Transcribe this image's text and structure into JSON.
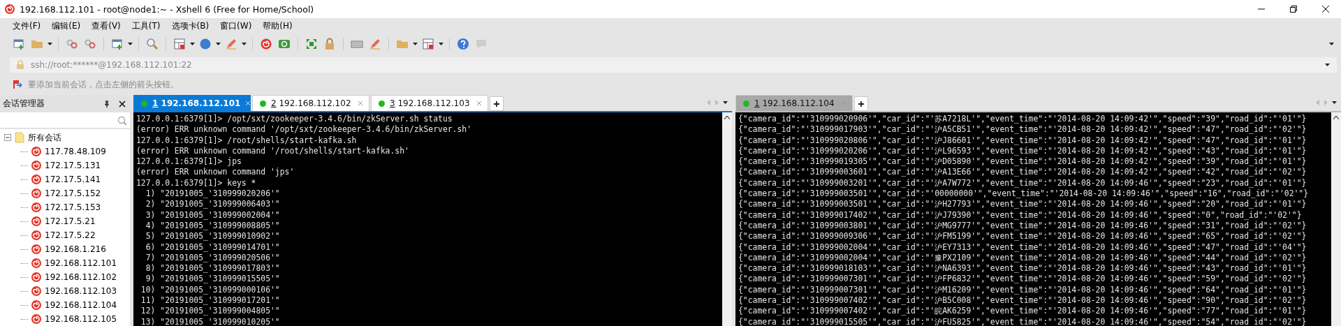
{
  "window": {
    "title": "192.168.112.101 - root@node1:~ - Xshell 6 (Free for Home/School)"
  },
  "menu": [
    "文件(F)",
    "编辑(E)",
    "查看(V)",
    "工具(T)",
    "选项卡(B)",
    "窗口(W)",
    "帮助(H)"
  ],
  "address_bar": {
    "value": "ssh://root:******@192.168.112.101:22"
  },
  "hint_bar": {
    "text": "要添加当前会话，点击左侧的箭头按钮。"
  },
  "sidebar": {
    "title": "会话管理器",
    "tree": [
      {
        "label": "所有会话",
        "expanded": true,
        "children": [
          {
            "label": "117.78.48.109"
          },
          {
            "label": "172.17.5.131"
          },
          {
            "label": "172.17.5.141"
          },
          {
            "label": "172.17.5.152"
          },
          {
            "label": "172.17.5.153"
          },
          {
            "label": "172.17.5.21"
          },
          {
            "label": "172.17.5.22"
          },
          {
            "label": "192.168.1.216"
          },
          {
            "label": "192.168.112.101"
          },
          {
            "label": "192.168.112.102"
          },
          {
            "label": "192.168.112.103"
          },
          {
            "label": "192.168.112.104"
          },
          {
            "label": "192.168.112.105"
          }
        ]
      }
    ]
  },
  "panes": [
    {
      "focused": true,
      "tabs": [
        {
          "number": "1",
          "label": "192.168.112.101",
          "selected": true,
          "connected": true
        },
        {
          "number": "2",
          "label": "192.168.112.102",
          "selected": false,
          "connected": true
        },
        {
          "number": "3",
          "label": "192.168.112.103",
          "selected": false,
          "connected": true
        }
      ],
      "lines": [
        "127.0.0.1:6379[1]> /opt/sxt/zookeeper-3.4.6/bin/zkServer.sh status",
        "(error) ERR unknown command '/opt/sxt/zookeeper-3.4.6/bin/zkServer.sh'",
        "127.0.0.1:6379[1]> /root/shells/start-kafka.sh",
        "(error) ERR unknown command '/root/shells/start-kafka.sh'",
        "127.0.0.1:6379[1]> jps",
        "(error) ERR unknown command 'jps'",
        "127.0.0.1:6379[1]> keys *",
        "  1) \"20191005_'310999020206'\"",
        "  2) \"20191005_'310999006403'\"",
        "  3) \"20191005_'310999002004'\"",
        "  4) \"20191005_'310999008805'\"",
        "  5) \"20191005_'310999010902'\"",
        "  6) \"20191005_'310999014701'\"",
        "  7) \"20191005_'310999020506'\"",
        "  8) \"20191005_'310999017803'\"",
        "  9) \"20191005_'310999015505'\"",
        " 10) \"20191005_'310999000106'\"",
        " 11) \"20191005_'310999017201'\"",
        " 12) \"20191005_'310999004805'\"",
        " 13) \"20191005_'310999010205'\""
      ]
    },
    {
      "focused": false,
      "tabs": [
        {
          "number": "1",
          "label": "192.168.112.104",
          "selected": true,
          "connected": true
        }
      ],
      "lines": [
        "{\"camera_id\":\"'310999020906'\",\"car_id\":\"'苏A7218L'\",\"event_time\":\"'2014-08-20 14:09:42'\",\"speed\":\"39\",\"road_id\":\"'01'\"}",
        "{\"camera_id\":\"'310999017903'\",\"car_id\":\"'沪A5CB51'\",\"event_time\":\"'2014-08-20 14:09:42'\",\"speed\":\"47\",\"road_id\":\"'02'\"}",
        "{\"camera_id\":\"'310999020806'\",\"car_id\":\"'沪J86601'\",\"event_time\":\"'2014-08-20 14:09:42'\",\"speed\":\"47\",\"road_id\":\"'01'\"}",
        "{\"camera_id\":\"'310999020206'\",\"car_id\":\"'沪L96593'\",\"event_time\":\"'2014-08-20 14:09:42'\",\"speed\":\"43\",\"road_id\":\"'01'\"}",
        "{\"camera_id\":\"'310999019305'\",\"car_id\":\"'沪D05890'\",\"event_time\":\"'2014-08-20 14:09:42'\",\"speed\":\"39\",\"road_id\":\"'01'\"}",
        "{\"camera_id\":\"'310999003601'\",\"car_id\":\"'沪A13E66'\",\"event_time\":\"'2014-08-20 14:09:42'\",\"speed\":\"42\",\"road_id\":\"'02'\"}",
        "{\"camera_id\":\"'310999003201'\",\"car_id\":\"'沪A7W772'\",\"event_time\":\"'2014-08-20 14:09:46'\",\"speed\":\"23\",\"road_id\":\"'01'\"}",
        "{\"camera_id\":\"'310999003501'\",\"car_id\":\"'00000000'\",\"event_time\":\"'2014-08-20 14:09:46'\",\"speed\":\"16\",\"road_id\":\"'02'\"}",
        "{\"camera_id\":\"'310999003501'\",\"car_id\":\"'沪H27793'\",\"event_time\":\"'2014-08-20 14:09:46'\",\"speed\":\"20\",\"road_id\":\"'01'\"}",
        "{\"camera_id\":\"'310999017402'\",\"car_id\":\"'沪J79390'\",\"event_time\":\"'2014-08-20 14:09:46'\",\"speed\":\"0\",\"road_id\":\"'02'\"}",
        "{\"camera_id\":\"'310999003801'\",\"car_id\":\"'沪MG9777'\",\"event_time\":\"'2014-08-20 14:09:46'\",\"speed\":\"31\",\"road_id\":\"'02'\"}",
        "{\"camera_id\":\"'310999009306'\",\"car_id\":\"'沪FM5199'\",\"event_time\":\"'2014-08-20 14:09:46'\",\"speed\":\"65\",\"road_id\":\"'02'\"}",
        "{\"camera_id\":\"'310999002004'\",\"car_id\":\"'沪EY7313'\",\"event_time\":\"'2014-08-20 14:09:46'\",\"speed\":\"47\",\"road_id\":\"'04'\"}",
        "{\"camera_id\":\"'310999002004'\",\"car_id\":\"'豫PX2109'\",\"event_time\":\"'2014-08-20 14:09:46'\",\"speed\":\"44\",\"road_id\":\"'02'\"}",
        "{\"camera_id\":\"'310999018103'\",\"car_id\":\"'沪NA6393'\",\"event_time\":\"'2014-08-20 14:09:46'\",\"speed\":\"43\",\"road_id\":\"'01'\"}",
        "{\"camera_id\":\"'310999007301'\",\"car_id\":\"'沪FP6832'\",\"event_time\":\"'2014-08-20 14:09:46'\",\"speed\":\"59\",\"road_id\":\"'02'\"}",
        "{\"camera_id\":\"'310999007301'\",\"car_id\":\"'沪M16209'\",\"event_time\":\"'2014-08-20 14:09:46'\",\"speed\":\"64\",\"road_id\":\"'01'\"}",
        "{\"camera_id\":\"'310999007402'\",\"car_id\":\"'沪B5C008'\",\"event_time\":\"'2014-08-20 14:09:46'\",\"speed\":\"90\",\"road_id\":\"'02'\"}",
        "{\"camera_id\":\"'310999007402'\",\"car_id\":\"'皖AK6259'\",\"event_time\":\"'2014-08-20 14:09:46'\",\"speed\":\"77\",\"road_id\":\"'01'\"}",
        "{\"camera_id\":\"'310999015505'\",\"car_id\":\"'沪FU5825'\",\"event_time\":\"'2014-08-20 14:09:46'\",\"speed\":\"54\",\"road_id\":\"'02'\"}"
      ]
    }
  ]
}
